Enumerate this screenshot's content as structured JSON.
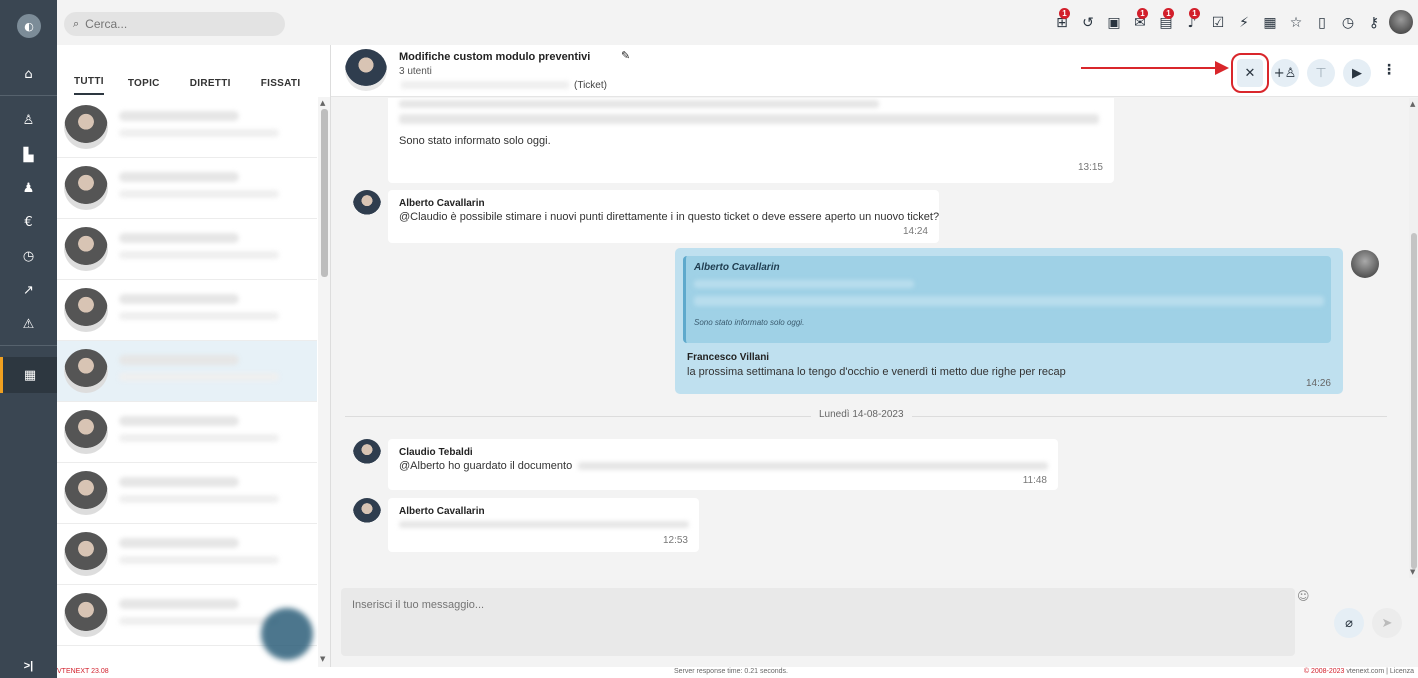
{
  "search": {
    "placeholder": "Cerca..."
  },
  "rail": {
    "items": [
      "home-icon",
      "user-icon",
      "building-icon",
      "person-icon",
      "euro-icon",
      "clock-icon",
      "trend-icon",
      "warning-icon",
      "grid-icon"
    ],
    "collapse": ">|"
  },
  "topbar": {
    "icons": [
      {
        "name": "process-icon",
        "glyph": "⊞",
        "badge": "1"
      },
      {
        "name": "history-icon",
        "glyph": "↺",
        "badge": ""
      },
      {
        "name": "calendar-icon",
        "glyph": "▣",
        "badge": ""
      },
      {
        "name": "mail-icon",
        "glyph": "✉",
        "badge": "1"
      },
      {
        "name": "chat-icon",
        "glyph": "▤",
        "badge": "1"
      },
      {
        "name": "bell-icon",
        "glyph": "♪",
        "badge": "1"
      },
      {
        "name": "task-icon",
        "glyph": "☑",
        "badge": ""
      },
      {
        "name": "flash-icon",
        "glyph": "⚡",
        "badge": ""
      },
      {
        "name": "contact-card-icon",
        "glyph": "▦",
        "badge": ""
      },
      {
        "name": "star-icon",
        "glyph": "☆",
        "badge": ""
      },
      {
        "name": "document-icon",
        "glyph": "▯",
        "badge": ""
      },
      {
        "name": "timer-icon",
        "glyph": "◷",
        "badge": ""
      },
      {
        "name": "key-icon",
        "glyph": "⚷",
        "badge": ""
      }
    ]
  },
  "tabs": [
    "TUTTI",
    "TOPIC",
    "DIRETTI",
    "FISSATI"
  ],
  "chatlist": {
    "count": 9,
    "selected_index": 4
  },
  "chat": {
    "title": "Modifiche custom modulo preventivi",
    "users": "3 utenti",
    "ticket": "(Ticket)",
    "messages": [
      {
        "text": "Sono stato informato solo oggi.",
        "time": "13:15"
      },
      {
        "name": "Alberto Cavallarin",
        "text": "@Claudio è possibile stimare i nuovi punti direttamente i in questo ticket o deve essere aperto un nuovo ticket?",
        "time": "14:24"
      },
      {
        "quote_name": "Alberto Cavallarin",
        "quote_text": "Sono stato informato solo oggi.",
        "name": "Francesco Villani",
        "text": "la prossima settimana lo tengo d'occhio e venerdì ti metto due righe per recap",
        "time": "14:26"
      },
      {
        "name": "Claudio Tebaldi",
        "text": "@Alberto ho guardato il documento",
        "time": "11:48"
      },
      {
        "name": "Alberto Cavallarin",
        "text": "",
        "time": "12:53"
      }
    ],
    "date_separator": "Lunedì 14-08-2023",
    "composer_placeholder": "Inserisci il tuo messaggio..."
  },
  "footer": {
    "version": "VTENEXT 23.08",
    "server": "Server response time: 0.21 seconds.",
    "copyright": "© 2008-2023",
    "site": "vtenext.com",
    "license": "| Licenza"
  },
  "colors": {
    "rail": "#3a4652",
    "badge": "#d21f2b",
    "annotation": "#d9262b",
    "own_bubble": "#bfe0ef"
  }
}
